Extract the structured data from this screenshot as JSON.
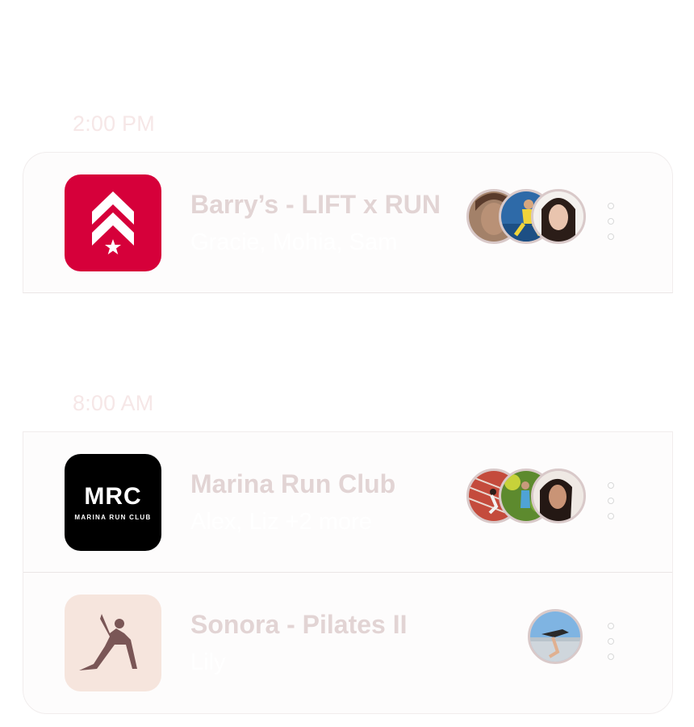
{
  "schedule": {
    "sections": [
      {
        "time": "2:00 PM",
        "events": [
          {
            "title": "Barry’s - LIFT x RUN",
            "attendees": "Gracie, Mohia, Sam",
            "logo_icon": "barrys-chevron-star-logo",
            "avatar_count": 3
          }
        ]
      },
      {
        "time": "8:00 AM",
        "events": [
          {
            "title": "Marina Run Club",
            "attendees": "Alex, Liz +2 more",
            "logo_icon": "mrc-logo",
            "logo_text": "MRC",
            "logo_subtext": "MARINA RUN CLUB",
            "avatar_count": 3
          },
          {
            "title": "Sonora - Pilates II",
            "attendees": "Lily",
            "logo_icon": "yoga-pose-logo",
            "avatar_count": 1
          }
        ]
      }
    ]
  },
  "colors": {
    "barrys_red": "#d6003a",
    "mrc_black": "#000000",
    "sonora_bg": "#f6e5dd",
    "sonora_figure": "#7a5656",
    "title_text": "#e2d4d4",
    "time_text": "#f6e7e7"
  }
}
